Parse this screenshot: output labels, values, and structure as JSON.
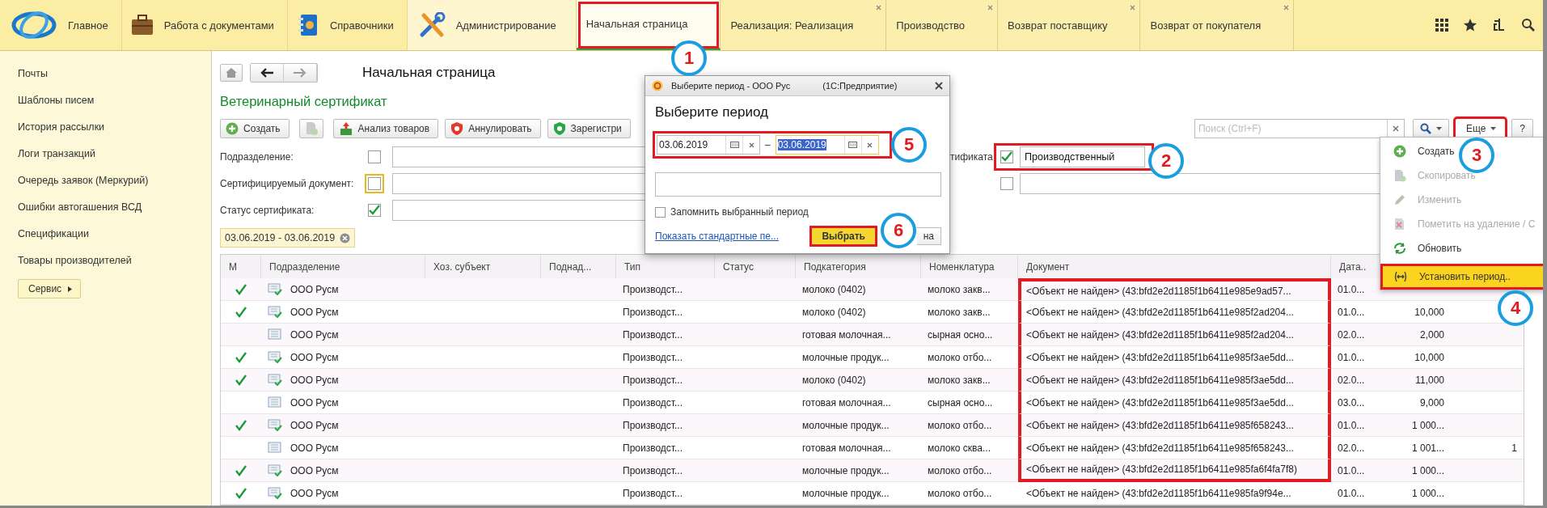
{
  "sections": [
    {
      "label": "Главное",
      "selected": false
    },
    {
      "label": "Работа с документами",
      "selected": false
    },
    {
      "label": "Справочники",
      "selected": false
    },
    {
      "label": "Администрирование",
      "selected": true
    }
  ],
  "tabs": [
    {
      "label": "Начальная страница",
      "selected": true,
      "highlighted": true,
      "closable": false
    },
    {
      "label": "Реализация: Реализация",
      "selected": false,
      "highlighted": false,
      "closable": true
    },
    {
      "label": "Производство",
      "selected": false,
      "highlighted": false,
      "closable": true
    },
    {
      "label": "Возврат поставщику",
      "selected": false,
      "highlighted": false,
      "closable": true
    },
    {
      "label": "Возврат от покупателя",
      "selected": false,
      "highlighted": false,
      "closable": true
    }
  ],
  "sidebar": {
    "items": [
      "Почты",
      "Шаблоны писем",
      "История рассылки",
      "Логи транзакций",
      "Очередь заявок (Меркурий)",
      "Ошибки автогашения ВСД",
      "Спецификации",
      "Товары производителей"
    ],
    "button": "Сервис"
  },
  "page_title": "Начальная страница",
  "form": {
    "title": "Ветеринарный сертификат",
    "toolbar": [
      {
        "kind": "create",
        "label": "Создать"
      },
      {
        "kind": "copy"
      },
      {
        "kind": "analyze",
        "label": "Анализ товаров"
      },
      {
        "kind": "cancel",
        "label": "Аннулировать"
      },
      {
        "kind": "register",
        "label": "Зарегистри"
      }
    ],
    "search": {
      "placeholder": "Поиск (Ctrl+F)"
    },
    "more_button": {
      "label": "Еще",
      "highlighted": true
    },
    "help_button": "?",
    "filters": [
      {
        "label": "Подразделение:",
        "checked": false,
        "focused": false
      },
      {
        "label": "Сертифицируемый документ:",
        "checked": false,
        "focused": true
      },
      {
        "label": "Статус сертификата:",
        "checked": true,
        "focused": false
      }
    ],
    "filters_right": [
      {
        "label": "тификата",
        "checked": true,
        "value": "Производственный",
        "highlighted": true
      },
      {
        "checked": false,
        "highlighted": false
      }
    ],
    "period_chip": "03.06.2019 - 03.06.2019"
  },
  "table": {
    "columns": [
      "М",
      "Подразделение",
      "Хоз. субъект",
      "Поднад...",
      "Тип",
      "Статус",
      "Подкатегория",
      "Номенклатура",
      "Документ",
      "Дата.."
    ],
    "rows": [
      {
        "marked": true,
        "subdivision": "ООО Русм",
        "type": "Производст...",
        "subcategory": "молоко (0402)",
        "nomenclature": "молоко закв...",
        "document": "<Объект не найден> (43:bfd2e2d1185f1b6411e985e9ad57...",
        "highlighted": true,
        "date": "01.0..."
      },
      {
        "marked": true,
        "subdivision": "ООО Русм",
        "type": "Производст...",
        "subcategory": "молоко (0402)",
        "nomenclature": "молоко закв...",
        "document": "<Объект не найден> (43:bfd2e2d1185f1b6411e985f2ad204...",
        "highlighted": true,
        "date": "01.0...",
        "column_11": "10,000"
      },
      {
        "marked": false,
        "subdivision": "ООО Русм",
        "type": "Производст...",
        "subcategory": "готовая молочная...",
        "nomenclature": "сырная осно...",
        "document": "<Объект не найден> (43:bfd2e2d1185f1b6411e985f2ad204...",
        "highlighted": true,
        "date": "02.0...",
        "column_11": "2,000"
      },
      {
        "marked": true,
        "subdivision": "ООО Русм",
        "type": "Производст...",
        "subcategory": "молочные продук...",
        "nomenclature": "молоко отбо...",
        "document": "<Объект не найден> (43:bfd2e2d1185f1b6411e985f3ae5dd...",
        "highlighted": true,
        "date": "01.0...",
        "column_11": "10,000"
      },
      {
        "marked": true,
        "subdivision": "ООО Русм",
        "type": "Производст...",
        "subcategory": "молоко (0402)",
        "nomenclature": "молоко закв...",
        "document": "<Объект не найден> (43:bfd2e2d1185f1b6411e985f3ae5dd...",
        "highlighted": true,
        "date": "02.0...",
        "column_11": "11,000"
      },
      {
        "marked": false,
        "subdivision": "ООО Русм",
        "type": "Производст...",
        "subcategory": "готовая молочная...",
        "nomenclature": "сырная осно...",
        "document": "<Объект не найден> (43:bfd2e2d1185f1b6411e985f3ae5dd...",
        "highlighted": true,
        "date": "03.0...",
        "column_11": "9,000"
      },
      {
        "marked": true,
        "subdivision": "ООО Русм",
        "type": "Производст...",
        "subcategory": "молочные продук...",
        "nomenclature": "молоко отбо...",
        "document": "<Объект не найден> (43:bfd2e2d1185f1b6411e985f658243...",
        "highlighted": true,
        "date": "01.0...",
        "column_11": "1 000..."
      },
      {
        "marked": false,
        "subdivision": "ООО Русм",
        "type": "Производст...",
        "subcategory": "готовая молочная...",
        "nomenclature": "молоко сква...",
        "document": "<Объект не найден> (43:bfd2e2d1185f1b6411e985f658243...",
        "highlighted": true,
        "date": "02.0...",
        "column_11": "1 001...",
        "column_12": "1"
      },
      {
        "marked": true,
        "subdivision": "ООО Русм",
        "type": "Производст...",
        "subcategory": "молочные продук...",
        "nomenclature": "молоко отбо...",
        "document": "<Объект не найден> (43:bfd2e2d1185f1b6411e985fa6f4fa7f8)",
        "highlighted": true,
        "date": "01.0...",
        "column_11": "1 000..."
      },
      {
        "marked": true,
        "subdivision": "ООО Русм",
        "type": "Производст...",
        "subcategory": "молочные продук...",
        "nomenclature": "молоко отбо...",
        "document": "<Объект не найден> (43:bfd2e2d1185f1b6411e985fa9f94e...",
        "highlighted": false,
        "date": "01.0...",
        "column_11": "1 000..."
      }
    ]
  },
  "menu": {
    "items": [
      {
        "label": "Создать",
        "disabled": false,
        "selected": false,
        "highlighted": false
      },
      {
        "label": "Скопировать",
        "disabled": true,
        "selected": false,
        "highlighted": false
      },
      {
        "label": "Изменить",
        "disabled": true,
        "selected": false,
        "highlighted": false
      },
      {
        "label": "Пометить на удаление / С",
        "disabled": true,
        "selected": false,
        "highlighted": false
      },
      {
        "label": "Обновить",
        "disabled": false,
        "selected": false,
        "highlighted": false
      },
      {
        "label": "Установить период..",
        "disabled": false,
        "selected": true,
        "highlighted": true
      }
    ]
  },
  "dialog": {
    "window_title": "Выберите период - ООО Рус",
    "app_name": "(1С:Предприятие)",
    "heading": "Выберите период",
    "date_from": "03.06.2019",
    "dash": "–",
    "date_to": "03.06.2019",
    "range_highlighted": true,
    "remember": {
      "label": "Запомнить выбранный период",
      "checked": false
    },
    "link": "Показать стандартные пе...",
    "ok_button": {
      "label": "Выбрать",
      "highlighted": true
    },
    "cancel_button": "на"
  },
  "callouts": [
    "1",
    "2",
    "3",
    "4",
    "5",
    "6"
  ]
}
